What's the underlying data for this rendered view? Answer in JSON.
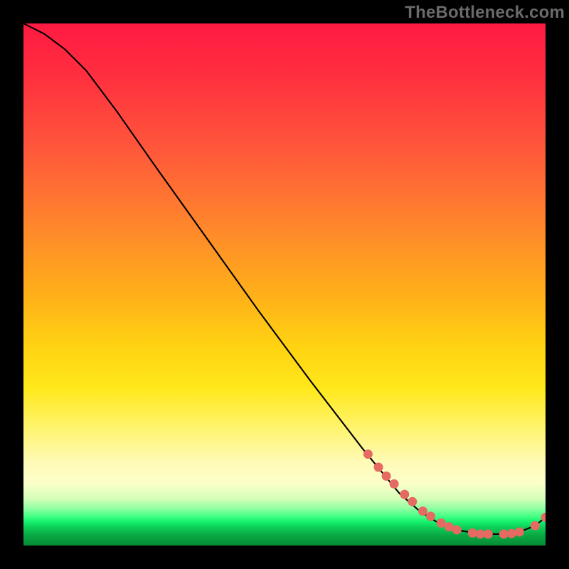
{
  "watermark": "TheBottleneck.com",
  "chart_data": {
    "type": "line",
    "title": "",
    "xlabel": "",
    "ylabel": "",
    "xlim": [
      0,
      100
    ],
    "ylim": [
      0,
      100
    ],
    "grid": false,
    "legend": false,
    "series": [
      {
        "name": "bottleneck-curve",
        "x": [
          0,
          4,
          8,
          12,
          18,
          25,
          35,
          45,
          55,
          65,
          72,
          76,
          80,
          84,
          88,
          92,
          95,
          98,
          100
        ],
        "y": [
          100,
          98,
          95,
          91,
          83,
          73,
          59,
          45,
          31.5,
          18.5,
          10,
          6.5,
          4,
          2.8,
          2.2,
          2.2,
          2.6,
          3.8,
          5.4
        ]
      }
    ],
    "markers": {
      "name": "highlight-points",
      "x": [
        66,
        68,
        69.5,
        71,
        73,
        74.5,
        76.5,
        78,
        80,
        81.5,
        83,
        86,
        87.5,
        89,
        92,
        93.5,
        95,
        98,
        100
      ],
      "y": [
        17.5,
        15,
        13.3,
        11.8,
        9.8,
        8.4,
        6.6,
        5.6,
        4.3,
        3.6,
        3.0,
        2.4,
        2.2,
        2.2,
        2.2,
        2.3,
        2.6,
        3.8,
        5.4
      ]
    },
    "colors": {
      "curve": "#000000",
      "markers": "#e46a62",
      "gradient_top": "#ff1a42",
      "gradient_mid": "#ffe81c",
      "gradient_bottom": "#058a35"
    }
  }
}
